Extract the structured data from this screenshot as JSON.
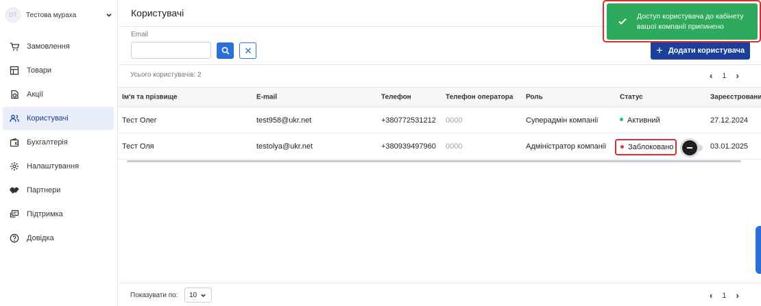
{
  "company": {
    "avatar_initials": "DT",
    "name": "Тестова мураха"
  },
  "sidebar": {
    "items": [
      {
        "label": "Замовлення",
        "icon": "cart-icon"
      },
      {
        "label": "Товари",
        "icon": "products-icon"
      },
      {
        "label": "Акції",
        "icon": "discount-icon"
      },
      {
        "label": "Користувачі",
        "icon": "users-icon",
        "active": true
      },
      {
        "label": "Бухгалтерія",
        "icon": "wallet-icon"
      },
      {
        "label": "Налаштування",
        "icon": "gear-icon"
      },
      {
        "label": "Партнери",
        "icon": "handshake-icon"
      },
      {
        "label": "Підтримка",
        "icon": "chat-icon"
      },
      {
        "label": "Довідка",
        "icon": "help-icon"
      }
    ]
  },
  "page": {
    "title": "Користувачі"
  },
  "filter": {
    "email_label": "Email",
    "email_value": "",
    "email_placeholder": ""
  },
  "toolbar": {
    "add_user_label": "Додати користувача"
  },
  "summary": {
    "total_label": "Усього користувачів: 2"
  },
  "pagination": {
    "current_page": "1",
    "prev": "‹",
    "next": "›"
  },
  "table": {
    "columns": [
      "Ім'я та прізвище",
      "E-mail",
      "Телефон",
      "Телефон оператора",
      "Роль",
      "Статус",
      "Зареєстрований"
    ],
    "rows": [
      {
        "name": "Тест Олег",
        "email": "test958@ukr.net",
        "phone": "+380772531212",
        "operator_phone": "0000",
        "role": "Суперадмін компанії",
        "status": "Активний",
        "status_color": "#1fbf7a",
        "registered": "27.12.2024"
      },
      {
        "name": "Тест Оля",
        "email": "testolya@ukr.net",
        "phone": "+380939497960",
        "operator_phone": "0000",
        "role": "Адміністратор компанії",
        "status": "Заблоковано",
        "status_color": "#e5383b",
        "registered": "03.01.2025"
      }
    ]
  },
  "footer": {
    "per_page_label": "Показувати по:",
    "per_page_value": "10"
  },
  "toast": {
    "message": "Доступ користувача до кабінету вашої компанії припинено",
    "color": "#2daa5b"
  },
  "colors": {
    "accent": "#1c3f9a",
    "primary_button": "#2d6fd8",
    "highlight_border": "#e02a2a"
  }
}
